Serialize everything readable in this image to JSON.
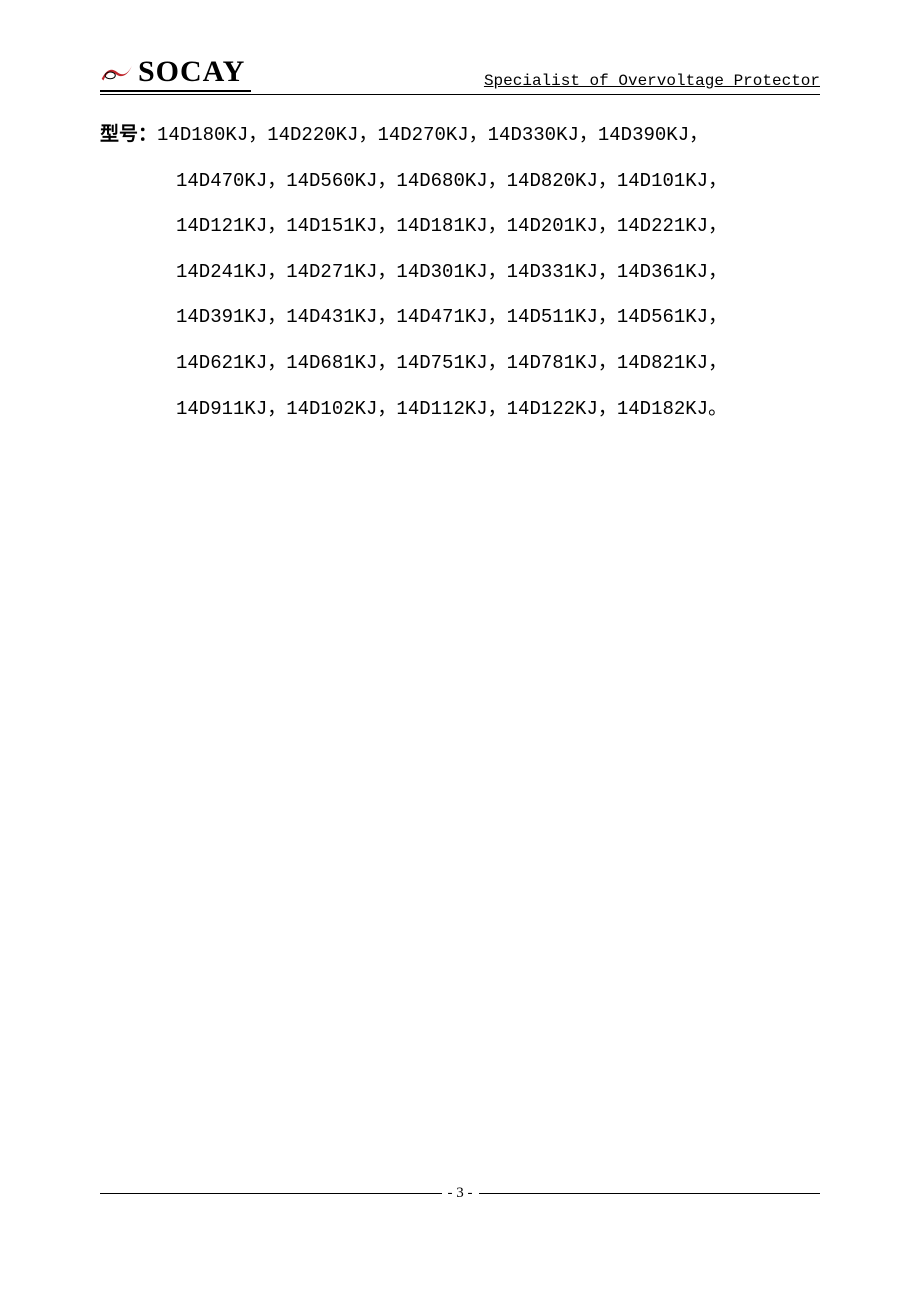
{
  "header": {
    "brand": "SOCAY",
    "tagline": "Specialist of Overvoltage Protector"
  },
  "content": {
    "label": "型号：",
    "rows": [
      "14D180KJ，14D220KJ，14D270KJ，14D330KJ，14D390KJ，",
      "14D470KJ，14D560KJ，14D680KJ，14D820KJ，14D101KJ，",
      "14D121KJ，14D151KJ，14D181KJ，14D201KJ，14D221KJ，",
      "14D241KJ，14D271KJ，14D301KJ，14D331KJ，14D361KJ，",
      "14D391KJ，14D431KJ，14D471KJ，14D511KJ，14D561KJ，",
      "14D621KJ，14D681KJ，14D751KJ，14D781KJ，14D821KJ，",
      "14D911KJ，14D102KJ，14D112KJ，14D122KJ，14D182KJ。"
    ]
  },
  "footer": {
    "page_number": "- 3 -"
  }
}
